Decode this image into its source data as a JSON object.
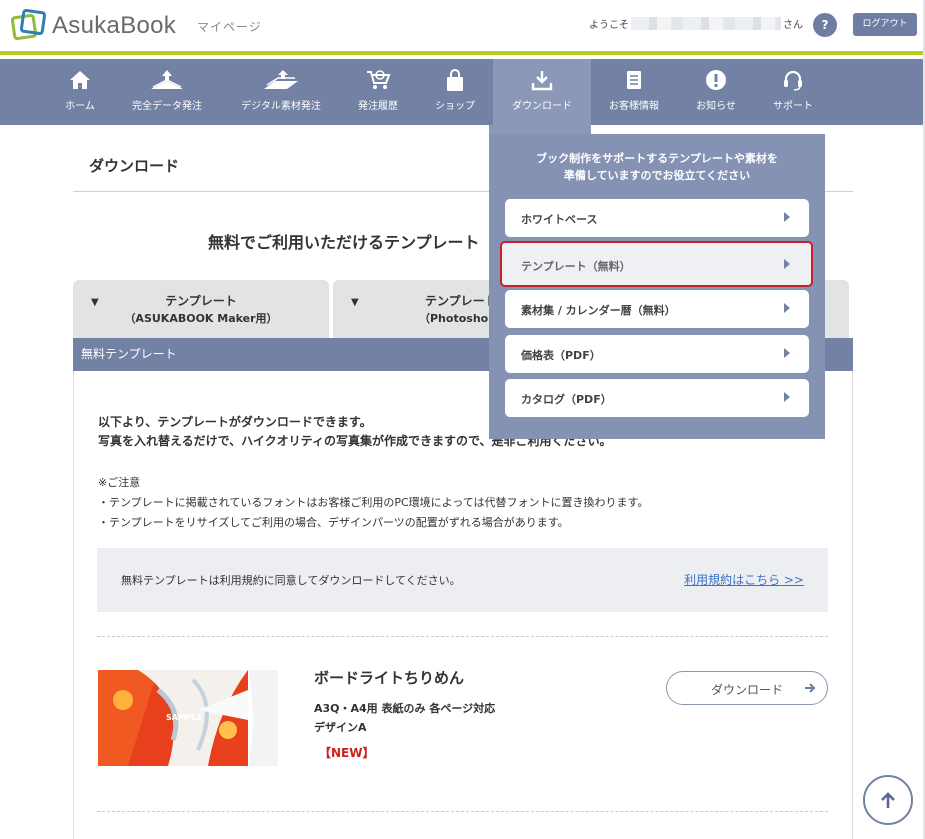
{
  "header": {
    "logo_text": "AsukaBook",
    "mypage": "マイページ",
    "welcome_prefix": "ようこそ",
    "welcome_suffix": "さん",
    "help_label": "?",
    "logout_label": "ログアウト"
  },
  "nav": {
    "items": [
      {
        "label": "ホーム",
        "icon": "home-icon"
      },
      {
        "label": "完全データ発注",
        "icon": "upload-book-icon"
      },
      {
        "label": "デジタル素材発注",
        "icon": "upload-material-icon"
      },
      {
        "label": "発注履歴",
        "icon": "cart-history-icon"
      },
      {
        "label": "ショップ",
        "icon": "shopping-bag-icon"
      },
      {
        "label": "ダウンロード",
        "icon": "download-icon"
      },
      {
        "label": "お客様情報",
        "icon": "document-icon"
      },
      {
        "label": "お知らせ",
        "icon": "exclamation-icon"
      },
      {
        "label": "サポート",
        "icon": "headset-icon"
      }
    ],
    "active": "ダウンロード"
  },
  "dropdown": {
    "intro_line1": "ブック制作をサポートするテンプレートや素材を",
    "intro_line2": "準備していますのでお役立てください",
    "items": [
      {
        "label": "ホワイトベース"
      },
      {
        "label": "テンプレート（無料）"
      },
      {
        "label": "素材集 / カレンダー暦（無料）"
      },
      {
        "label": "価格表（PDF）"
      },
      {
        "label": "カタログ（PDF）"
      }
    ],
    "selected": "テンプレート（無料）"
  },
  "page": {
    "title": "ダウンロード",
    "section_heading": "無料でご利用いただけるテンプレート",
    "tabs": [
      {
        "line1": "テンプレート",
        "line2": "（ASUKABOOK Maker用）"
      },
      {
        "line1": "テンプレート",
        "line2": "（Photoshop用）"
      }
    ],
    "bar_title": "無料テンプレート",
    "intro_line1": "以下より、テンプレートがダウンロードできます。",
    "intro_line2": "写真を入れ替えるだけで、ハイクオリティの写真集が作成できますので、是非ご利用ください。",
    "notes_title": "※ご注意",
    "note1": "・テンプレートに掲載されているフォントはお客様ご利用のPC環境によっては代替フォントに置き換わります。",
    "note2": "・テンプレートをリサイズしてご利用の場合、デザインパーツの配置がずれる場合があります。",
    "agree_text": "無料テンプレートは利用規約に同意してダウンロードしてください。",
    "agree_link": "利用規約はこちら >>"
  },
  "product": {
    "name": "ボードライトちりめん",
    "desc_line1": "A3Q・A4用 表紙のみ 各ページ対応",
    "desc_line2": "デザインA",
    "badge": "【NEW】",
    "download_label": "ダウンロード",
    "thumb_text": "SAMPLE"
  },
  "colors": {
    "nav": "#7381a5",
    "accent_line": "#b8cc1c",
    "highlight": "#c8202a",
    "link": "#3a73c8"
  }
}
